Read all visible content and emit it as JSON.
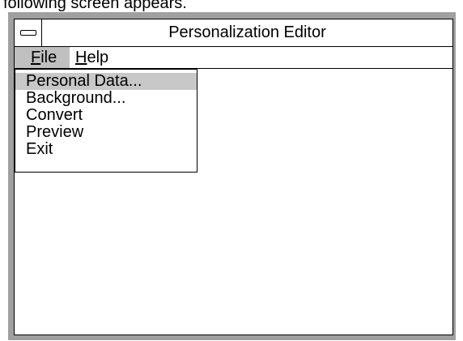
{
  "top_caption": "following screen appears.",
  "window": {
    "title": "Personalization Editor",
    "system_menu_icon": "system-menu-icon"
  },
  "menubar": {
    "file": {
      "prefix": "",
      "mnemonic": "F",
      "rest": "ile"
    },
    "help": {
      "prefix": "",
      "mnemonic": "H",
      "rest": "elp"
    }
  },
  "file_menu": {
    "items": [
      {
        "label": "Personal Data...",
        "selected": true
      },
      {
        "label": "Background...",
        "selected": false
      },
      {
        "label": "Convert",
        "selected": false
      },
      {
        "label": "Preview",
        "selected": false
      },
      {
        "label": "Exit",
        "selected": false
      }
    ]
  },
  "colors": {
    "frame": "#a0a0a0",
    "highlight": "#c8c8c8",
    "menu_active": "#c0c0c0"
  }
}
